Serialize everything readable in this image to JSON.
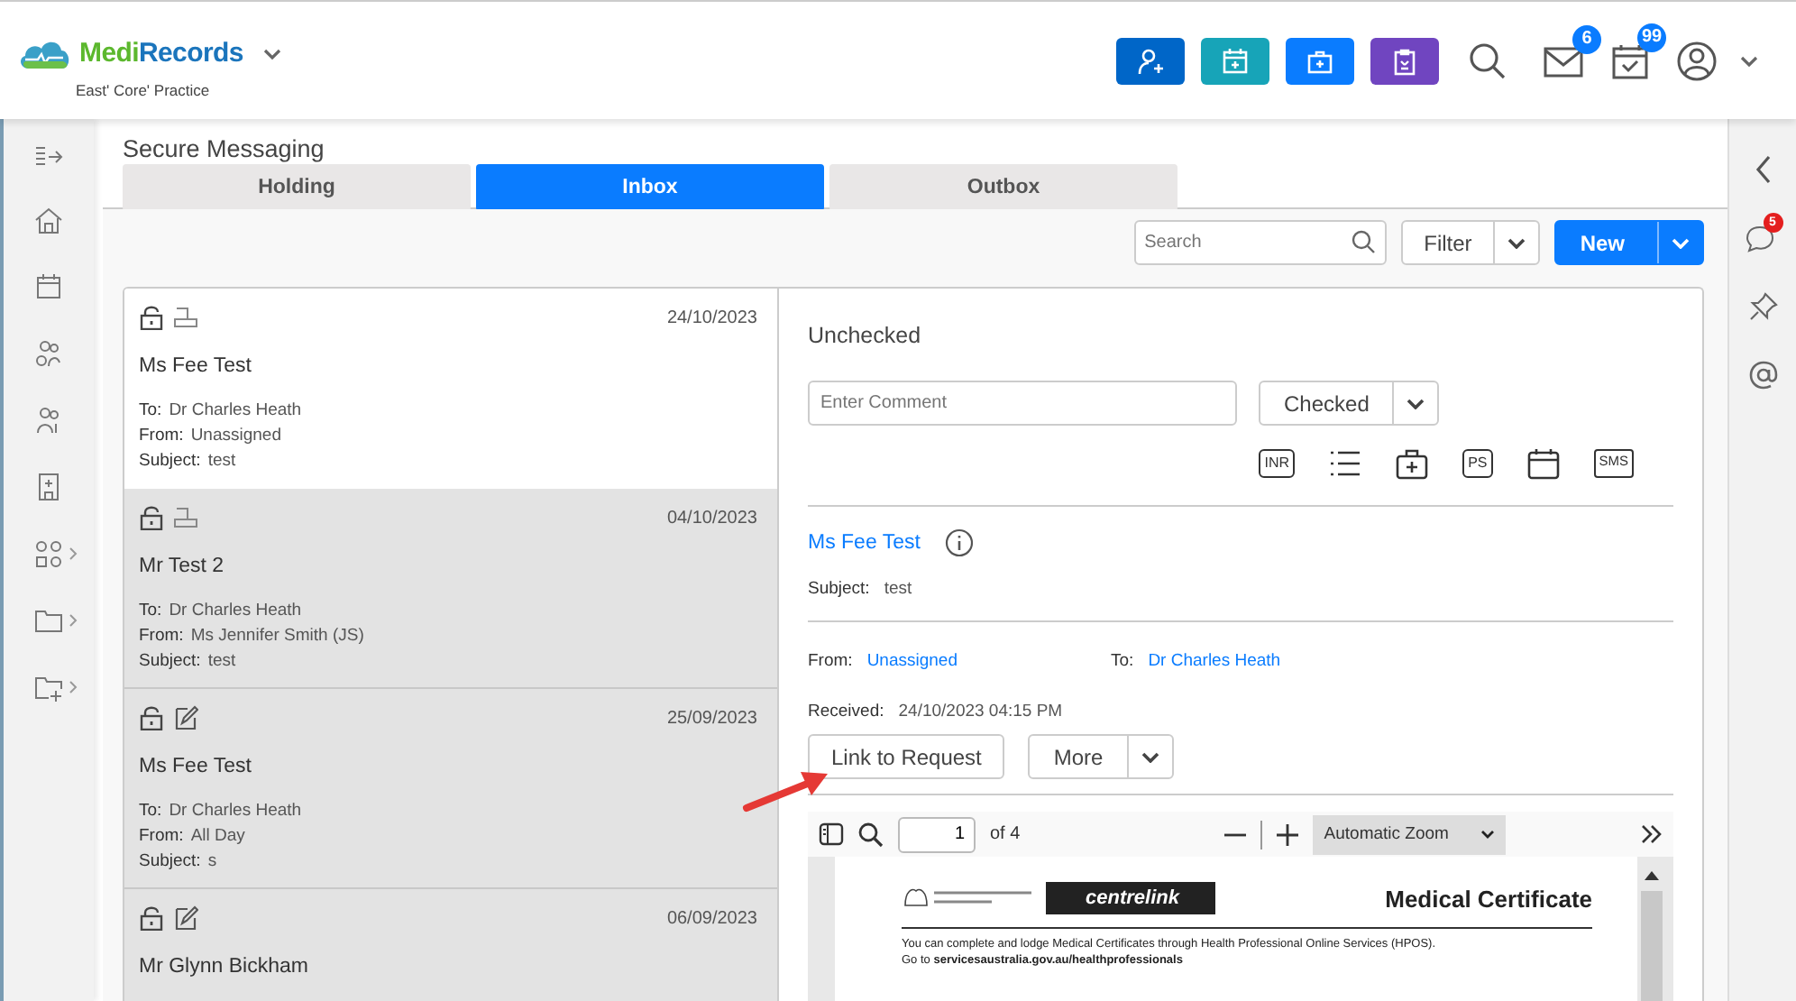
{
  "app": {
    "brand_first": "Medi",
    "brand_rest": "Records",
    "practice": "East' Core' Practice"
  },
  "header": {
    "mail_badge": "6",
    "tasks_badge": "99"
  },
  "right_rail": {
    "chat_badge": "5"
  },
  "page_title": "Secure Messaging",
  "tabs": [
    {
      "label": "Holding",
      "selected": false
    },
    {
      "label": "Inbox",
      "selected": true
    },
    {
      "label": "Outbox",
      "selected": false
    }
  ],
  "toolbar": {
    "search_placeholder": "Search",
    "filter": "Filter",
    "new": "New"
  },
  "messages": [
    {
      "kind": "scan",
      "selected": true,
      "date": "24/10/2023",
      "name": "Ms Fee Test",
      "fields": [
        {
          "label": "To:",
          "value": "Dr Charles Heath"
        },
        {
          "label": "From:",
          "value": "Unassigned"
        },
        {
          "label": "Subject:",
          "value": "test"
        }
      ]
    },
    {
      "kind": "scan",
      "selected": false,
      "date": "04/10/2023",
      "name": "Mr Test 2",
      "fields": [
        {
          "label": "To:",
          "value": "Dr Charles Heath"
        },
        {
          "label": "From:",
          "value": "Ms Jennifer Smith (JS)"
        },
        {
          "label": "Subject:",
          "value": "test"
        }
      ]
    },
    {
      "kind": "note",
      "selected": false,
      "date": "25/09/2023",
      "name": "Ms Fee Test",
      "fields": [
        {
          "label": "To:",
          "value": "Dr Charles Heath"
        },
        {
          "label": "From:",
          "value": "All Day"
        },
        {
          "label": "Subject:",
          "value": "s"
        }
      ]
    },
    {
      "kind": "note",
      "selected": false,
      "date": "06/09/2023",
      "name": "Mr Glynn Bickham"
    }
  ],
  "detail": {
    "status": "Unchecked",
    "comment_placeholder": "Enter Comment",
    "checked_button": "Checked",
    "action_icons": [
      {
        "kind": "text",
        "text": "INR"
      },
      {
        "kind": "list"
      },
      {
        "kind": "kit"
      },
      {
        "kind": "text",
        "text": "PS"
      },
      {
        "kind": "calendar"
      },
      {
        "kind": "speech",
        "text": "SMS"
      }
    ],
    "patient": "Ms Fee Test",
    "subject_label": "Subject:",
    "subject": "test",
    "from_label": "From:",
    "from": "Unassigned",
    "to_label": "To:",
    "to": "Dr Charles Heath",
    "received_label": "Received:",
    "received": "24/10/2023 04:15 PM",
    "link_button": "Link to Request",
    "more_button": "More"
  },
  "pdf_viewer": {
    "page": "1",
    "page_count": "of 4",
    "zoom": "Automatic Zoom",
    "document": {
      "logo": "centrelink",
      "title": "Medical Certificate",
      "lines": [
        "You can complete and lodge Medical Certificates through Health Professional Online Services (HPOS).",
        "Go to **servicesaustralia.gov.au/healthprofessionals**"
      ]
    }
  }
}
